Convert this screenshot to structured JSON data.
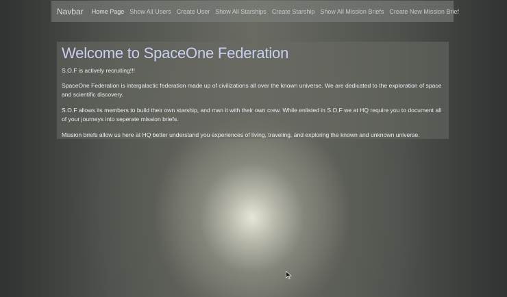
{
  "navbar": {
    "brand": "Navbar",
    "items": [
      {
        "label": "Home Page"
      },
      {
        "label": "Show All Users"
      },
      {
        "label": "Create User"
      },
      {
        "label": "Show All Starships"
      },
      {
        "label": "Create Starship"
      },
      {
        "label": "Show All Mission Briefs"
      },
      {
        "label": "Create New Mission Brief"
      }
    ]
  },
  "main": {
    "title": "Welcome to SpaceOne Federation",
    "paragraphs": [
      "S.O.F is actively recruiting!!!",
      "SpaceOne Federation is intergalactic federation made up of civilizations all over the known universe. We are dedicated to the exploration of space and scientific discovery.",
      "S.O.F allows its members to build their own starship, and man it with their own crew. While enlisted in S.O.F we at HQ require you to document all of your journeys into seperate mission briefs.",
      "Mission briefs allow us here at HQ better understand you experiences of living, traveling, and exploring the known and unknown universe."
    ]
  },
  "colors": {
    "title": "#c9cfee",
    "navbar_bg": "#82857f",
    "jumbotron_bg": "#696c64"
  }
}
